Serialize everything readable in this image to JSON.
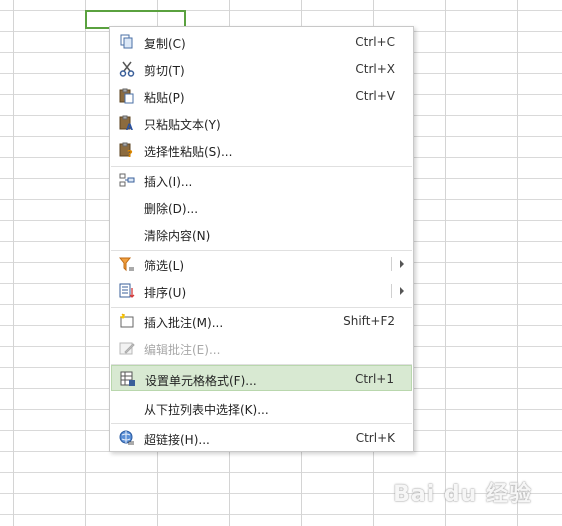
{
  "menu": {
    "items": [
      {
        "label": "复制(C)",
        "shortcut": "Ctrl+C",
        "icon": "copy-icon"
      },
      {
        "label": "剪切(T)",
        "shortcut": "Ctrl+X",
        "icon": "scissors-icon"
      },
      {
        "label": "粘贴(P)",
        "shortcut": "Ctrl+V",
        "icon": "paste-icon"
      },
      {
        "label": "只粘贴文本(Y)",
        "shortcut": "",
        "icon": "paste-text-icon"
      },
      {
        "label": "选择性粘贴(S)...",
        "shortcut": "",
        "icon": "paste-special-icon"
      },
      {
        "label": "插入(I)...",
        "shortcut": "",
        "icon": "insert-icon"
      },
      {
        "label": "删除(D)...",
        "shortcut": "",
        "icon": ""
      },
      {
        "label": "清除内容(N)",
        "shortcut": "",
        "icon": ""
      },
      {
        "label": "筛选(L)",
        "shortcut": "",
        "icon": "filter-icon",
        "submenu": true
      },
      {
        "label": "排序(U)",
        "shortcut": "",
        "icon": "sort-icon",
        "submenu": true
      },
      {
        "label": "插入批注(M)...",
        "shortcut": "Shift+F2",
        "icon": "insert-comment-icon"
      },
      {
        "label": "编辑批注(E)...",
        "shortcut": "",
        "icon": "edit-comment-icon",
        "disabled": true
      },
      {
        "label": "设置单元格格式(F)...",
        "shortcut": "Ctrl+1",
        "icon": "format-cells-icon",
        "highlighted": true
      },
      {
        "label": "从下拉列表中选择(K)...",
        "shortcut": "",
        "icon": ""
      },
      {
        "label": "超链接(H)...",
        "shortcut": "Ctrl+K",
        "icon": "hyperlink-icon"
      }
    ]
  },
  "watermark": {
    "text": "Bai du 经验"
  },
  "colors": {
    "highlight": "#d8e9d2",
    "selection_border": "#5aa13f",
    "disabled_text": "#a8a8a8"
  }
}
